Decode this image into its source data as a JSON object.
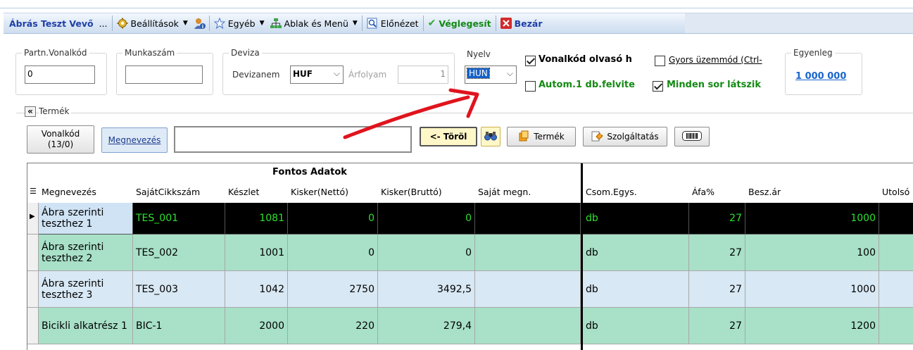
{
  "toolbar": {
    "title": "Ábrás Teszt Vevő",
    "ellipsis": "...",
    "settings": "Beállítások",
    "other": "Egyéb",
    "window_menu": "Ablak és Menü",
    "preview": "Előnézet",
    "finalize": "Véglegesít",
    "close": "Bezár"
  },
  "header": {
    "partner_barcode_label": "Partn.Vonalkód",
    "partner_barcode_value": "0",
    "work_number_label": "Munkaszám",
    "work_number_value": "",
    "currency_label": "Deviza",
    "currency_name_label": "Devizanem",
    "currency_value": "HUF",
    "rate_label": "Árfolyam",
    "rate_value": "1",
    "language_label": "Nyelv",
    "language_value": "HUN",
    "barcode_reader_label": "Vonalkód olvasó h",
    "barcode_reader_checked": true,
    "fast_mode_label": "Gyors üzemmód (Ctrl-",
    "fast_mode_checked": false,
    "auto_add_label": "Autom.1 db.felvite",
    "auto_add_checked": false,
    "all_rows_label": "Minden sor látszik",
    "all_rows_checked": true,
    "balance_label": "Egyenleg",
    "balance_value": "1 000 000"
  },
  "product": {
    "section_label": "Termék",
    "collapse_glyph": "«",
    "barcode_btn_line1": "Vonalkód",
    "barcode_btn_line2": "(13/0)",
    "name_btn": "Megnevezés",
    "search_value": "",
    "delete_btn": "<- Töröl",
    "product_btn": "Termék",
    "service_btn": "Szolgáltatás"
  },
  "grid": {
    "group_header": "Fontos Adatok",
    "columns": [
      "Megnevezés",
      "SajátCikkszám",
      "Készlet",
      "Kisker(Nettó)",
      "Kisker(Bruttó)",
      "Saját megn.",
      "Csom.Egys.",
      "Áfa%",
      "Besz.ár",
      "Utolsó"
    ],
    "rows": [
      [
        "Ábra szerinti teszthez 1",
        "TES_001",
        "1081",
        "0",
        "0",
        "",
        "db",
        "27",
        "1000",
        ""
      ],
      [
        "Ábra szerinti teszthez 2",
        "TES_002",
        "1001",
        "0",
        "0",
        "",
        "db",
        "27",
        "100",
        ""
      ],
      [
        "Ábra szerinti teszthez 3",
        "TES_003",
        "1042",
        "2750",
        "3492,5",
        "",
        "db",
        "27",
        "1000",
        ""
      ],
      [
        "Bicikli alkatrész 1",
        "BIC-1",
        "2000",
        "220",
        "279,4",
        "",
        "db",
        "27",
        "1200",
        ""
      ]
    ]
  },
  "colors": {
    "accent_blue": "#1f3fa6",
    "finalize_green": "#148a14",
    "selected_row_bg": "#000000",
    "selected_row_text": "#2de12d",
    "row_green": "#a8e0c8",
    "row_light": "#d8e8f4",
    "arrow_red": "#e0141e"
  }
}
